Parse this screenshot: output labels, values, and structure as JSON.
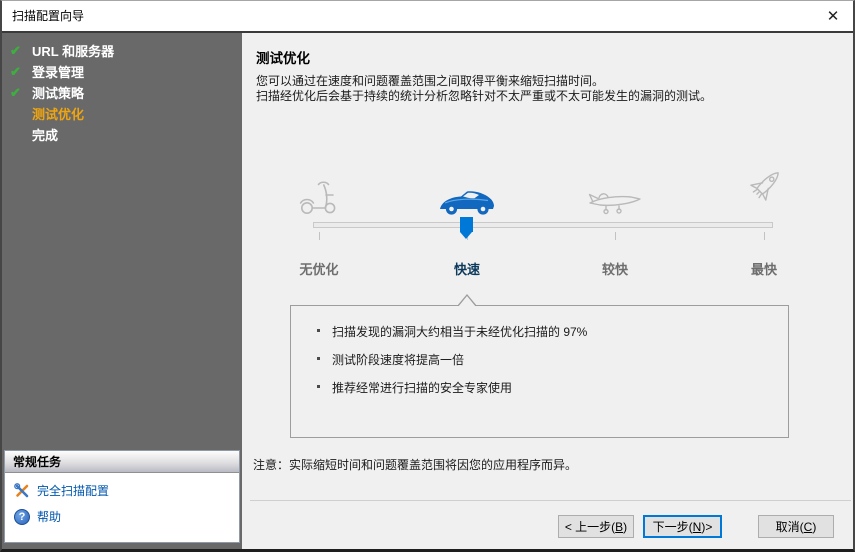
{
  "window": {
    "title": "扫描配置向导",
    "close_glyph": "✕"
  },
  "sidebar": {
    "steps": [
      {
        "label": "URL 和服务器",
        "check": "✔",
        "state": "done"
      },
      {
        "label": "登录管理",
        "check": "✔",
        "state": "done"
      },
      {
        "label": "测试策略",
        "check": "✔",
        "state": "done"
      },
      {
        "label": "测试优化",
        "check": "",
        "state": "current"
      },
      {
        "label": "完成",
        "check": "",
        "state": "pending"
      }
    ],
    "tasks": {
      "title": "常规任务",
      "links": [
        {
          "label": "完全扫描配置",
          "icon": "tools-icon"
        },
        {
          "label": "帮助",
          "icon": "help-icon",
          "glyph": "?"
        }
      ]
    }
  },
  "main": {
    "heading": "测试优化",
    "intro_line1": "您可以通过在速度和问题覆盖范围之间取得平衡来缩短扫描时间。",
    "intro_line2": "扫描经优化后会基于持续的统计分析忽略针对不太严重或不太可能发生的漏洞的测试。",
    "slider": {
      "selected_index": 1,
      "options": [
        {
          "label": "无优化",
          "icon": "scooter-icon"
        },
        {
          "label": "快速",
          "icon": "sports-car-icon"
        },
        {
          "label": "较快",
          "icon": "jet-plane-icon"
        },
        {
          "label": "最快",
          "icon": "rocket-icon"
        }
      ]
    },
    "bullets": [
      "扫描发现的漏洞大约相当于未经优化扫描的 97%",
      "测试阶段速度将提高一倍",
      "推荐经常进行扫描的安全专家使用"
    ],
    "note": "注意：实际缩短时间和问题覆盖范围将因您的应用程序而异。"
  },
  "footer": {
    "back": {
      "pre": "< 上一步(",
      "key": "B",
      "post": ")"
    },
    "next": {
      "pre": "下一步(",
      "key": "N",
      "post": ")>"
    },
    "cancel": {
      "pre": "取消(",
      "key": "C",
      "post": ")"
    }
  },
  "colors": {
    "accent_blue": "#0078d7",
    "selected_label": "#0d3a5c",
    "check_green": "#3fae41",
    "current_step": "#efa510",
    "sidebar_bg": "#696969",
    "link_blue": "#0057ae"
  }
}
